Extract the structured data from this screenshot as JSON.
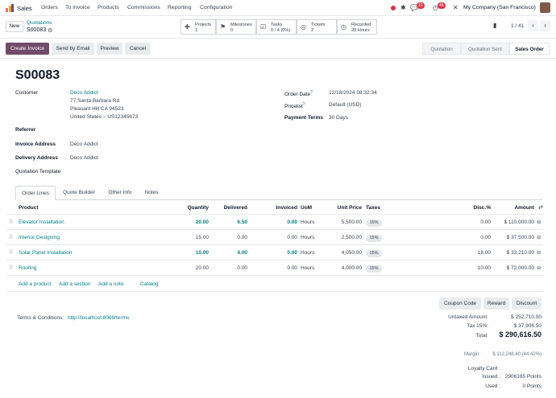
{
  "navbar": {
    "app_name": "Sales",
    "menus": [
      "Orders",
      "To Invoice",
      "Products",
      "Commissions",
      "Reporting",
      "Configuration"
    ],
    "chat_badge": "10",
    "activity_badge": "48",
    "company": "My Company (San Francisco)",
    "brand_color": "#714b67"
  },
  "breadcrumb": {
    "new_label": "New",
    "parent": "Quotations",
    "current": "S00083"
  },
  "smart_buttons": [
    {
      "icon": "puzzle-icon",
      "line1": "Projects",
      "line2": "1"
    },
    {
      "icon": "flag-icon",
      "line1": "Milestones",
      "line2": "0"
    },
    {
      "icon": "tasks-icon",
      "line1": "Tasks",
      "line2": "0 / 4 (0%)"
    },
    {
      "icon": "life-ring-icon",
      "line1": "Tickets",
      "line2": "2"
    },
    {
      "icon": "clock-icon",
      "line1": "Recorded",
      "line2": "28 Hours"
    }
  ],
  "pager": "1 / 41",
  "actions": {
    "create_invoice": "Create Invoice",
    "send_email": "Send by Email",
    "preview": "Preview",
    "cancel": "Cancel"
  },
  "statusbar": [
    "Quotation",
    "Quotation Sent",
    "Sales Order"
  ],
  "order": {
    "name": "S00083",
    "customer_label": "Customer",
    "customer_name": "Deco Addict",
    "address1": "77 Santa Barbara Rd",
    "address2": "Pleasant Hill CA 94523",
    "address3": "United States – US12345673",
    "order_date_label": "Order Date",
    "order_date": "12/18/2024 08:32:34",
    "pricelist_label": "Pricelist",
    "pricelist": "Default (USD)",
    "payment_terms_label": "Payment Terms",
    "payment_terms": "30 Days",
    "referrer_label": "Referrer",
    "invoice_address_label": "Invoice Address",
    "invoice_address": "Deco Addict",
    "delivery_address_label": "Delivery Address",
    "delivery_address": "Deco Addict",
    "quotation_template_label": "Quotation Template"
  },
  "tabs": [
    "Order Lines",
    "Quote Builder",
    "Other Info",
    "Notes"
  ],
  "table": {
    "headers": {
      "product": "Product",
      "quantity": "Quantity",
      "delivered": "Delivered",
      "invoiced": "Invoiced",
      "uom": "UoM",
      "unit_price": "Unit Price",
      "taxes": "Taxes",
      "disc": "Disc.%",
      "amount": "Amount"
    },
    "rows": [
      {
        "product": "Elevator Installation",
        "quantity": "20.00",
        "delivered": "6.50",
        "invoiced": "0.00",
        "uom": "Hours",
        "unit_price": "5,500.00",
        "tax": "15%",
        "disc": "0.00",
        "amount": "$ 110,000.00"
      },
      {
        "product": "Interior Designing",
        "quantity": "15.00",
        "delivered": "0.00",
        "invoiced": "0.00",
        "uom": "Hours",
        "unit_price": "2,500.00",
        "tax": "15%",
        "disc": "0.00",
        "amount": "$ 37,500.00"
      },
      {
        "product": "Solar Panel Installation",
        "quantity": "10.00",
        "delivered": "4.00",
        "invoiced": "0.00",
        "uom": "Hours",
        "unit_price": "4,050.00",
        "tax": "15%",
        "disc": "18.00",
        "amount": "$ 33,210.00"
      },
      {
        "product": "Roofing",
        "quantity": "20.00",
        "delivered": "0.00",
        "invoiced": "0.00",
        "uom": "Hours",
        "unit_price": "4,000.00",
        "tax": "15%",
        "disc": "10.00",
        "amount": "$ 72,000.00"
      }
    ],
    "add_product": "Add a product",
    "add_section": "Add a section",
    "add_note": "Add a note",
    "catalog": "Catalog"
  },
  "bottom": {
    "coupon_code": "Coupon Code",
    "reward": "Reward",
    "discount": "Discount",
    "terms_label": "Terms & Conditions:",
    "terms_link": "http://localhost:8069/terms",
    "untaxed_label": "Untaxed Amount:",
    "untaxed_value": "$ 252,710.00",
    "tax_label": "Tax 15%:",
    "tax_value": "$ 37,906.50",
    "total_label": "Total:",
    "total_value": "$ 290,616.50",
    "margin_label": "Margin:",
    "margin_value": "$ 112,248.40 (44.42%)",
    "loyalty_label": "Loyalty Card :",
    "issued_label": "Issued :",
    "issued_value": "2906165 Points",
    "used_label": "Used :",
    "used_value": "0 Points"
  }
}
